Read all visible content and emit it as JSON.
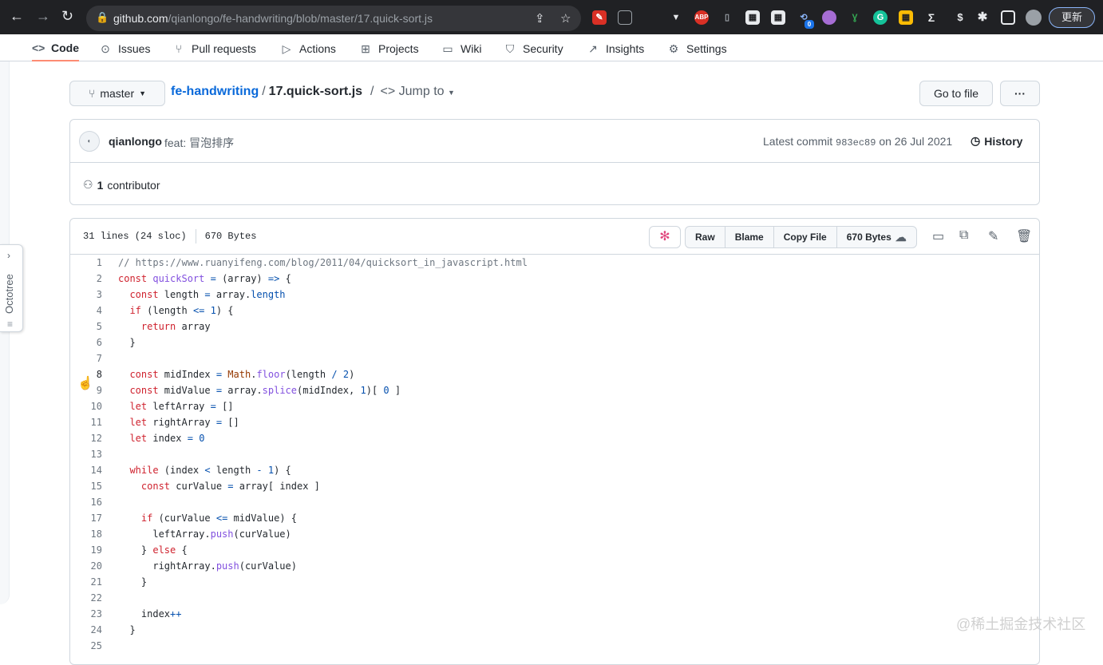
{
  "browser": {
    "url_host": "github.com",
    "url_path": "/qianlongo/fe-handwriting/blob/master/17.quick-sort.js",
    "update_label": "更新",
    "badge_count": "0"
  },
  "repo_nav": {
    "tabs": [
      {
        "label": "Code",
        "icon": "code-icon"
      },
      {
        "label": "Issues",
        "icon": "issue-icon"
      },
      {
        "label": "Pull requests",
        "icon": "pull-request-icon"
      },
      {
        "label": "Actions",
        "icon": "play-icon"
      },
      {
        "label": "Projects",
        "icon": "table-icon"
      },
      {
        "label": "Wiki",
        "icon": "book-icon"
      },
      {
        "label": "Security",
        "icon": "shield-icon"
      },
      {
        "label": "Insights",
        "icon": "graph-icon"
      },
      {
        "label": "Settings",
        "icon": "gear-icon"
      }
    ]
  },
  "octotree": {
    "label": "Octotree"
  },
  "breadcrumb": {
    "branch": "master",
    "repo": "fe-handwriting",
    "separator": "/",
    "file": "17.quick-sort.js",
    "jump_to": "Jump to",
    "go_to_file": "Go to file",
    "more": "···"
  },
  "commit": {
    "author": "qianlongo",
    "message": "feat: 冒泡排序",
    "latest_prefix": "Latest commit",
    "sha": "983ec89",
    "date": "on 26 Jul 2021",
    "history": "History",
    "contributors_count": "1",
    "contributors_label": "contributor"
  },
  "file": {
    "lines_info": "31 lines (24 sloc)",
    "size": "670 Bytes",
    "raw": "Raw",
    "blame": "Blame",
    "copy_file": "Copy File",
    "download_size": "670 Bytes"
  },
  "code_lines": [
    "// https://www.ruanyifeng.com/blog/2011/04/quicksort_in_javascript.html",
    "const quickSort = (array) => {",
    "  const length = array.length",
    "  if (length <= 1) {",
    "    return array",
    "  }",
    "",
    "  const midIndex = Math.floor(length / 2)",
    "  const midValue = array.splice(midIndex, 1)[ 0 ]",
    "  let leftArray = []",
    "  let rightArray = []",
    "  let index = 0",
    "",
    "  while (index < length - 1) {",
    "    const curValue = array[ index ]",
    "",
    "    if (curValue <= midValue) {",
    "      leftArray.push(curValue)",
    "    } else {",
    "      rightArray.push(curValue)",
    "    }",
    "",
    "    index++",
    "  }",
    ""
  ],
  "active_line": 8,
  "watermark": "@稀土掘金技术社区"
}
